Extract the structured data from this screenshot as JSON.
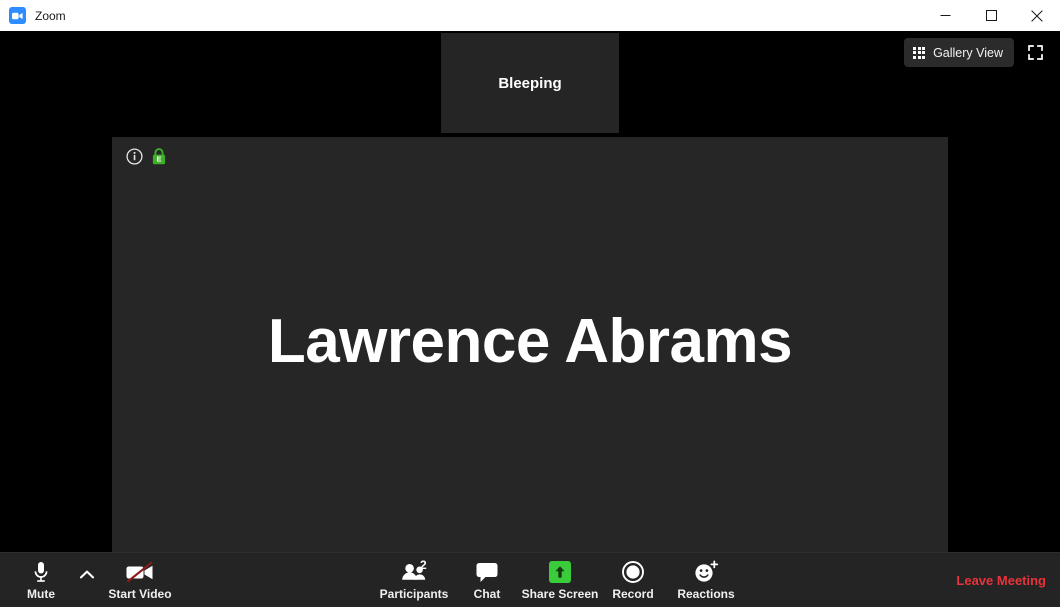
{
  "window": {
    "title": "Zoom",
    "app_icon": "zoom-video-icon",
    "controls": {
      "minimize": "minimize-icon",
      "maximize": "maximize-icon",
      "close": "close-icon"
    }
  },
  "stage": {
    "view_controls": {
      "gallery_view_label": "Gallery View",
      "gallery_icon": "grid-icon",
      "fullscreen_icon": "fullscreen-icon"
    },
    "thumbnails": [
      {
        "name": "Bleeping"
      }
    ],
    "active_speaker": {
      "name": "Lawrence Abrams",
      "info_icon": "info-circle-icon",
      "encryption_icon": "green-lock-e2ee-icon"
    }
  },
  "toolbar": {
    "mute": {
      "label": "Mute",
      "icon": "microphone-icon"
    },
    "audio_options": {
      "icon": "chevron-up-icon"
    },
    "start_video": {
      "label": "Start Video",
      "icon": "video-camera-off-icon"
    },
    "participants": {
      "label": "Participants",
      "icon": "participants-icon",
      "count": "2"
    },
    "chat": {
      "label": "Chat",
      "icon": "chat-bubble-icon"
    },
    "share_screen": {
      "label": "Share Screen",
      "icon": "share-screen-up-arrow-icon"
    },
    "record": {
      "label": "Record",
      "icon": "record-circle-icon"
    },
    "reactions": {
      "label": "Reactions",
      "icon": "smiley-plus-icon"
    },
    "leave": {
      "label": "Leave Meeting"
    }
  },
  "colors": {
    "accent_blue": "#2D8CFF",
    "share_green": "#3ACC3A",
    "lock_green": "#3FAE29",
    "leave_red": "#E8333A",
    "video_off_red": "#8B1A1A",
    "stage_black": "#000000",
    "panel_gray": "#262626",
    "toolbar_gray": "#242424"
  }
}
